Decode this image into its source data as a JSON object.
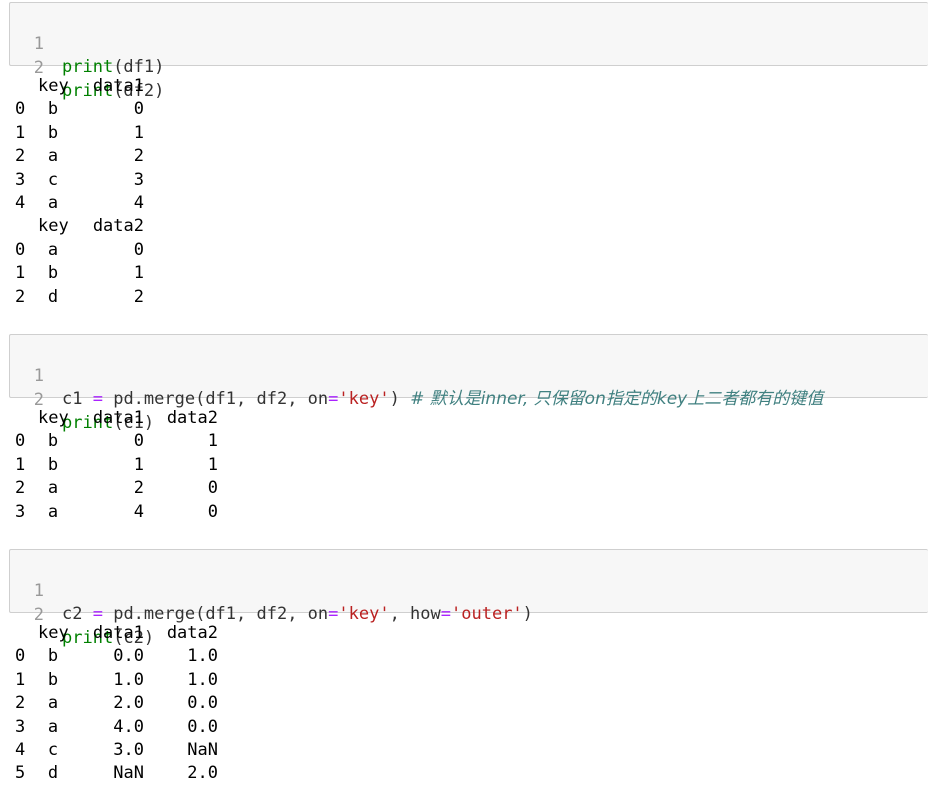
{
  "cells": [
    {
      "lines": [
        {
          "num": "1",
          "parts": [
            {
              "t": "print",
              "c": "fn"
            },
            {
              "t": "(df1)",
              "c": ""
            }
          ]
        },
        {
          "num": "2",
          "parts": [
            {
              "t": "print",
              "c": "fn"
            },
            {
              "t": "(df2)",
              "c": ""
            }
          ]
        }
      ]
    },
    {
      "lines": [
        {
          "num": "1",
          "parts": [
            {
              "t": "c1 ",
              "c": ""
            },
            {
              "t": "=",
              "c": "op"
            },
            {
              "t": " pd.merge(df1, df2, on",
              "c": ""
            },
            {
              "t": "=",
              "c": "op"
            },
            {
              "t": "'key'",
              "c": "str"
            },
            {
              "t": ") ",
              "c": ""
            },
            {
              "t": "# 默认是inner, 只保留on指定的key上二者都有的键值",
              "c": "cm"
            }
          ]
        },
        {
          "num": "2",
          "parts": [
            {
              "t": "print",
              "c": "fn"
            },
            {
              "t": "(c1)",
              "c": ""
            }
          ]
        }
      ]
    },
    {
      "lines": [
        {
          "num": "1",
          "parts": [
            {
              "t": "c2 ",
              "c": ""
            },
            {
              "t": "=",
              "c": "op"
            },
            {
              "t": " pd.merge(df1, df2, on",
              "c": ""
            },
            {
              "t": "=",
              "c": "op"
            },
            {
              "t": "'key'",
              "c": "str"
            },
            {
              "t": ", how",
              "c": ""
            },
            {
              "t": "=",
              "c": "op"
            },
            {
              "t": "'outer'",
              "c": "str"
            },
            {
              "t": ")",
              "c": ""
            }
          ]
        },
        {
          "num": "2",
          "parts": [
            {
              "t": "print",
              "c": "fn"
            },
            {
              "t": "(c2)",
              "c": ""
            }
          ]
        }
      ]
    }
  ],
  "outputs": [
    {
      "rows": [
        {
          "idx": "",
          "key": "key",
          "d1": "data1",
          "d2": ""
        },
        {
          "idx": "0",
          "key": "b",
          "d1": "0",
          "d2": ""
        },
        {
          "idx": "1",
          "key": "b",
          "d1": "1",
          "d2": ""
        },
        {
          "idx": "2",
          "key": "a",
          "d1": "2",
          "d2": ""
        },
        {
          "idx": "3",
          "key": "c",
          "d1": "3",
          "d2": ""
        },
        {
          "idx": "4",
          "key": "a",
          "d1": "4",
          "d2": ""
        },
        {
          "idx": "",
          "key": "key",
          "d1": "data2",
          "d2": ""
        },
        {
          "idx": "0",
          "key": "a",
          "d1": "0",
          "d2": ""
        },
        {
          "idx": "1",
          "key": "b",
          "d1": "1",
          "d2": ""
        },
        {
          "idx": "2",
          "key": "d",
          "d1": "2",
          "d2": ""
        }
      ]
    },
    {
      "rows": [
        {
          "idx": "",
          "key": "key",
          "d1": "data1",
          "d2": "data2"
        },
        {
          "idx": "0",
          "key": "b",
          "d1": "0",
          "d2": "1"
        },
        {
          "idx": "1",
          "key": "b",
          "d1": "1",
          "d2": "1"
        },
        {
          "idx": "2",
          "key": "a",
          "d1": "2",
          "d2": "0"
        },
        {
          "idx": "3",
          "key": "a",
          "d1": "4",
          "d2": "0"
        }
      ]
    },
    {
      "rows": [
        {
          "idx": "",
          "key": "key",
          "d1": "data1",
          "d2": "data2"
        },
        {
          "idx": "0",
          "key": "b",
          "d1": "0.0",
          "d2": "1.0"
        },
        {
          "idx": "1",
          "key": "b",
          "d1": "1.0",
          "d2": "1.0"
        },
        {
          "idx": "2",
          "key": "a",
          "d1": "2.0",
          "d2": "0.0"
        },
        {
          "idx": "3",
          "key": "a",
          "d1": "4.0",
          "d2": "0.0"
        },
        {
          "idx": "4",
          "key": "c",
          "d1": "3.0",
          "d2": "NaN"
        },
        {
          "idx": "5",
          "key": "d",
          "d1": "NaN",
          "d2": "2.0"
        }
      ]
    }
  ]
}
